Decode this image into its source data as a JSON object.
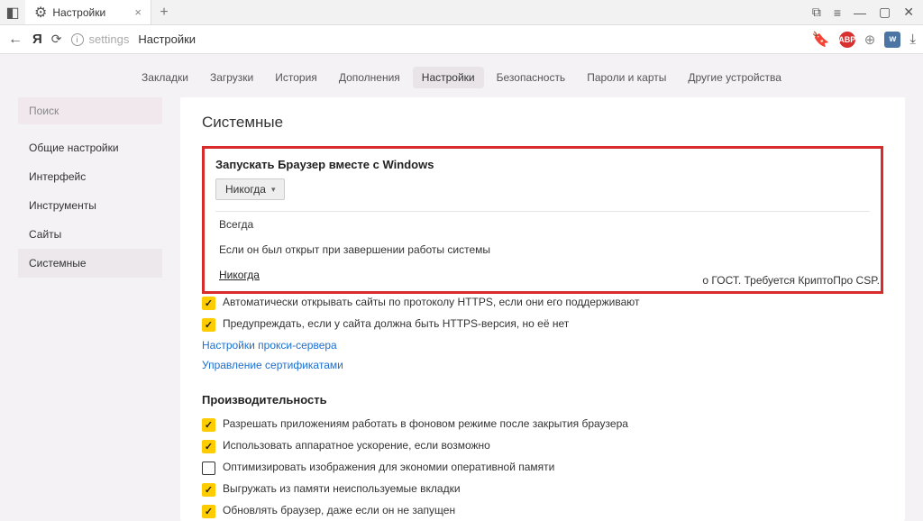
{
  "titlebar": {
    "tab_title": "Настройки",
    "tab_close": "×",
    "newtab": "+",
    "icons": {
      "minimize": "—",
      "maximize": "▢",
      "close": "✕"
    }
  },
  "addrbar": {
    "back": "←",
    "ya": "Я",
    "reload": "⟳",
    "path": "settings",
    "title": "Настройки"
  },
  "topnav": [
    {
      "label": "Закладки"
    },
    {
      "label": "Загрузки"
    },
    {
      "label": "История"
    },
    {
      "label": "Дополнения"
    },
    {
      "label": "Настройки",
      "active": true
    },
    {
      "label": "Безопасность"
    },
    {
      "label": "Пароли и карты"
    },
    {
      "label": "Другие устройства"
    }
  ],
  "sidebar": {
    "search": "Поиск",
    "items": [
      "Общие настройки",
      "Интерфейс",
      "Инструменты",
      "Сайты",
      "Системные"
    ]
  },
  "content": {
    "title": "Системные",
    "startup": {
      "heading": "Запускать Браузер вместе с Windows",
      "selected": "Никогда",
      "options": [
        "Всегда",
        "Если он был открыт при завершении работы системы",
        "Никогда"
      ]
    },
    "trail": "о ГОСТ. Требуется КриптоПро CSP.",
    "net_rows": [
      {
        "checked": true,
        "label": "Автоматически открывать сайты по протоколу HTTPS, если они его поддерживают"
      },
      {
        "checked": true,
        "label": "Предупреждать, если у сайта должна быть HTTPS-версия, но её нет"
      }
    ],
    "links": [
      "Настройки прокси-сервера",
      "Управление сертификатами"
    ],
    "perf_heading": "Производительность",
    "perf_rows": [
      {
        "checked": true,
        "label": "Разрешать приложениям работать в фоновом режиме после закрытия браузера"
      },
      {
        "checked": true,
        "label": "Использовать аппаратное ускорение, если возможно"
      },
      {
        "checked": false,
        "label": "Оптимизировать изображения для экономии оперативной памяти"
      },
      {
        "checked": true,
        "label": "Выгружать из памяти неиспользуемые вкладки"
      },
      {
        "checked": true,
        "label": "Обновлять браузер, даже если он не запущен"
      }
    ]
  }
}
